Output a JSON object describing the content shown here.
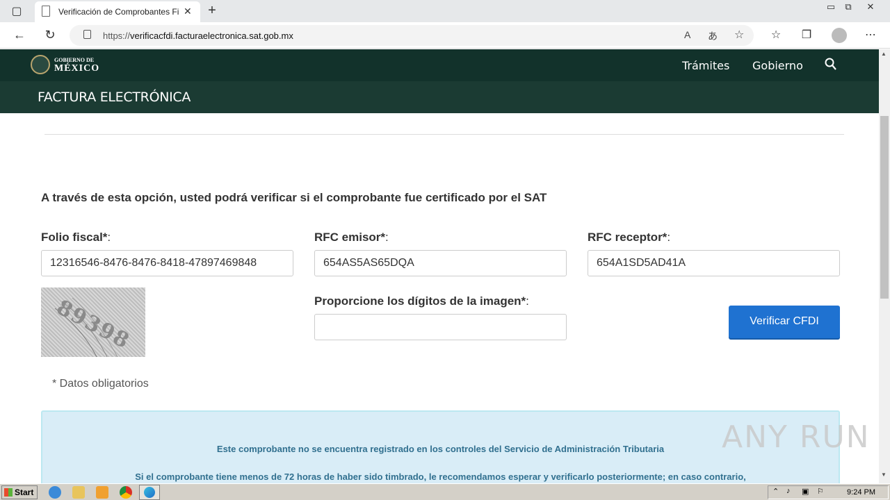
{
  "browser": {
    "tab_title": "Verificación de Comprobantes Fi",
    "url_prefix": "https://",
    "url_host": "verificacfdi.facturaelectronica.sat.gob.mx"
  },
  "gov_header": {
    "logo_line1": "GOBIERNO DE",
    "logo_line2": "MÉXICO",
    "nav": [
      "Trámites",
      "Gobierno"
    ],
    "subtitle": "FACTURA ELECTRÓNICA"
  },
  "form": {
    "intro": "A través de esta opción, usted podrá verificar si el comprobante fue certificado por el SAT",
    "folio_label": "Folio fiscal*",
    "folio_value": "12316546-8476-8476-8418-47897469848",
    "rfc_emisor_label": "RFC emisor*",
    "rfc_emisor_value": "654AS5AS65DQA",
    "rfc_receptor_label": "RFC receptor*",
    "rfc_receptor_value": "654A1SD5AD41A",
    "captcha_label": "Proporcione los dígitos de la imagen*",
    "captcha_text": "89398",
    "captcha_value": "",
    "verify_button": "Verificar CFDI",
    "required_note": "* Datos obligatorios",
    "colon": ":"
  },
  "alert": {
    "line1": "Este comprobante no se encuentra registrado en los controles del Servicio de Administración Tributaria",
    "line2": "Si el comprobante tiene menos de 72 horas de haber sido timbrado, le recomendamos esperar y verificarlo posteriormente; en caso contrario,"
  },
  "taskbar": {
    "start": "Start",
    "clock": "9:24 PM"
  },
  "watermark": "ANY RUN",
  "colors": {
    "header_dark": "#12322b",
    "header_sub": "#1b3b33",
    "button_blue": "#1f72d1",
    "alert_bg": "#d9edf7",
    "alert_text": "#31708f"
  }
}
